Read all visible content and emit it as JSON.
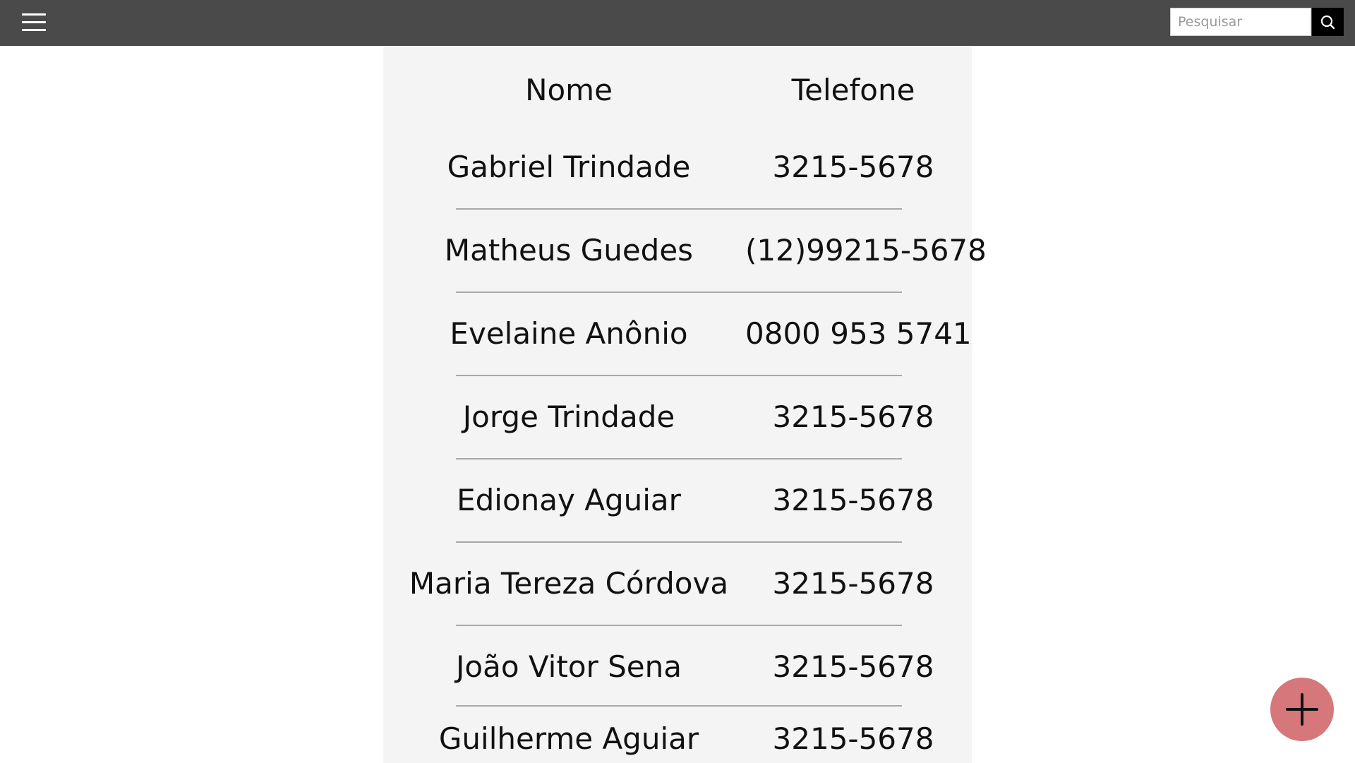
{
  "search": {
    "placeholder": "Pesquisar"
  },
  "table": {
    "headers": {
      "name": "Nome",
      "phone": "Telefone"
    },
    "rows": [
      {
        "name": "Gabriel Trindade",
        "phone": "3215-5678"
      },
      {
        "name": "Matheus Guedes",
        "phone": "(12)99215-5678"
      },
      {
        "name": "Evelaine Anônio",
        "phone": "0800 953 5741"
      },
      {
        "name": "Jorge Trindade",
        "phone": "3215-5678"
      },
      {
        "name": "Edionay Aguiar",
        "phone": "3215-5678"
      },
      {
        "name": "Maria Tereza Córdova",
        "phone": "3215-5678"
      },
      {
        "name": "João Vitor Sena",
        "phone": "3215-5678"
      },
      {
        "name": "Guilherme Aguiar",
        "phone": "3215-5678"
      }
    ]
  },
  "icons": {
    "menu": "hamburger-menu-icon",
    "search": "search-icon",
    "add": "plus-icon"
  },
  "colors": {
    "topbar": "#4a4a4a",
    "panel": "#f4f4f4",
    "fab": "#d6777b"
  }
}
